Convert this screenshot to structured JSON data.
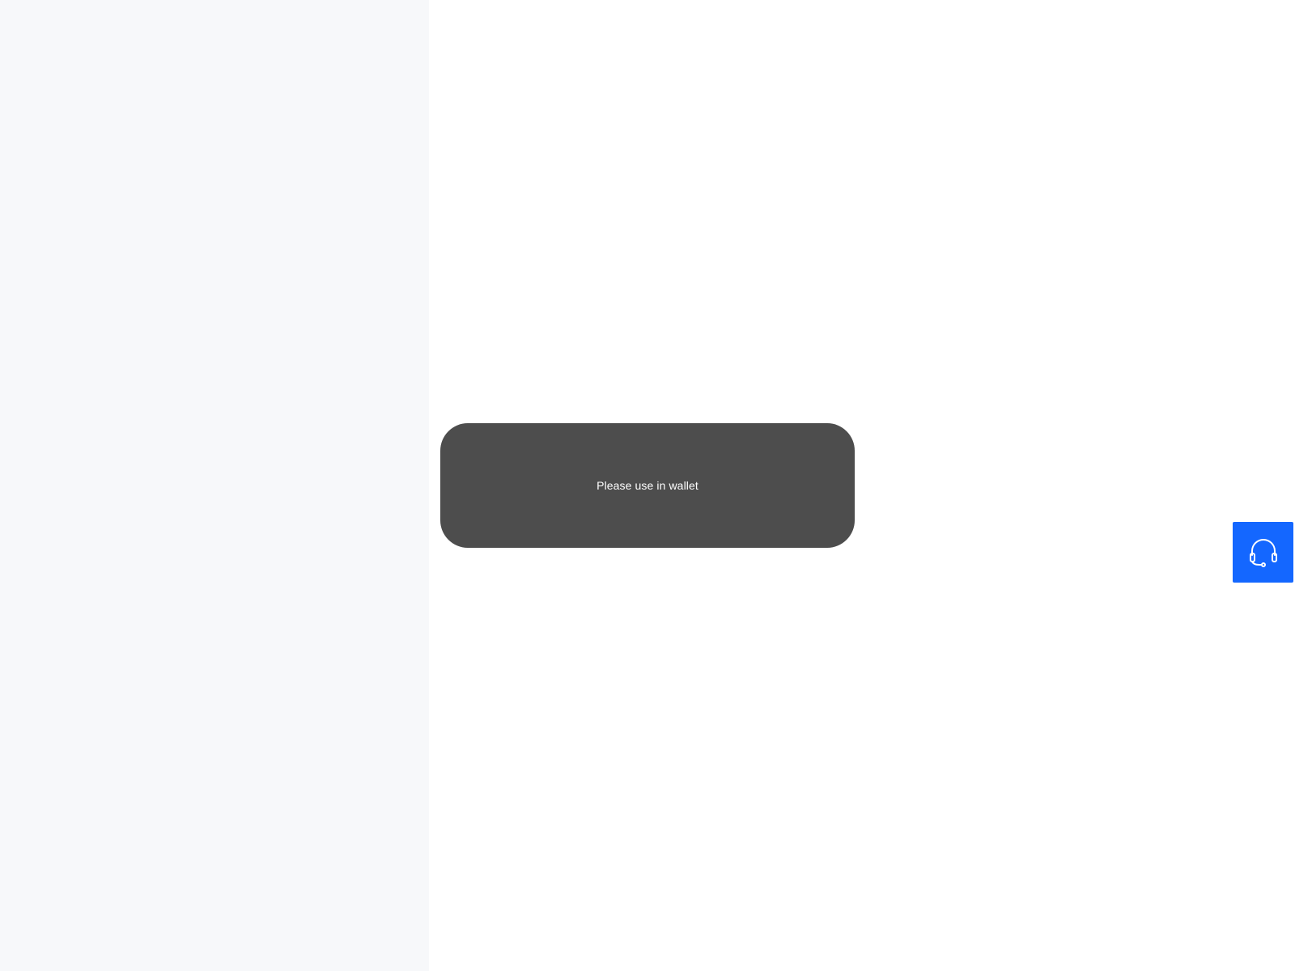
{
  "toast": {
    "message": "Please use in wallet"
  },
  "support": {
    "icon": "headset-icon",
    "color": "#1467ff"
  },
  "colors": {
    "left_panel": "#f7f8fa",
    "main_panel": "#ffffff",
    "toast_background": "#4d4d4d",
    "toast_text": "#ffffff"
  }
}
